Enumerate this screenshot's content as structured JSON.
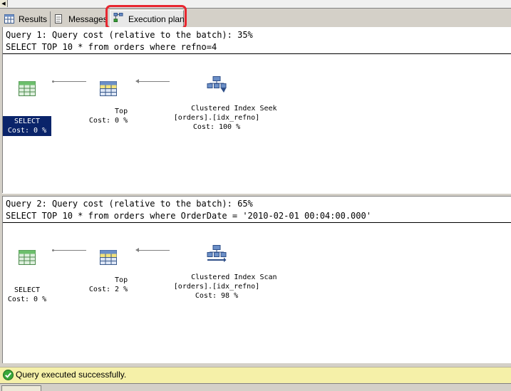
{
  "tabs": [
    {
      "label": "Results",
      "icon": "grid-icon"
    },
    {
      "label": "Messages",
      "icon": "document-icon"
    },
    {
      "label": "Execution plan",
      "icon": "execution-plan-icon"
    }
  ],
  "queries": [
    {
      "header": "Query 1: Query cost (relative to the batch): 35%",
      "sql": "SELECT TOP 10 * from orders where refno=4",
      "nodes": [
        {
          "name": "SELECT",
          "cost": "Cost: 0 %",
          "icon": "select-table-icon",
          "selected": true
        },
        {
          "name": "Top",
          "cost": "Cost: 0 %",
          "icon": "top-table-icon"
        },
        {
          "name": "Clustered Index Seek",
          "object": "[orders].[idx_refno]",
          "cost": "Cost: 100 %",
          "icon": "index-seek-icon"
        }
      ]
    },
    {
      "header": "Query 2: Query cost (relative to the batch): 65%",
      "sql": "SELECT TOP 10 * from orders where OrderDate = '2010-02-01 00:04:00.000'",
      "nodes": [
        {
          "name": "SELECT",
          "cost": "Cost: 0 %",
          "icon": "select-table-icon"
        },
        {
          "name": "Top",
          "cost": "Cost: 2 %",
          "icon": "top-table-icon"
        },
        {
          "name": "Clustered Index Scan",
          "object": "[orders].[idx_refno]",
          "cost": "Cost: 98 %",
          "icon": "index-scan-icon"
        }
      ]
    }
  ],
  "status": {
    "text": "Query executed successfully.",
    "icon": "success-check-icon"
  },
  "colors": {
    "highlight": "#e8262f",
    "selected_node": "#0a246a",
    "status_bar": "#f5f0a8"
  }
}
